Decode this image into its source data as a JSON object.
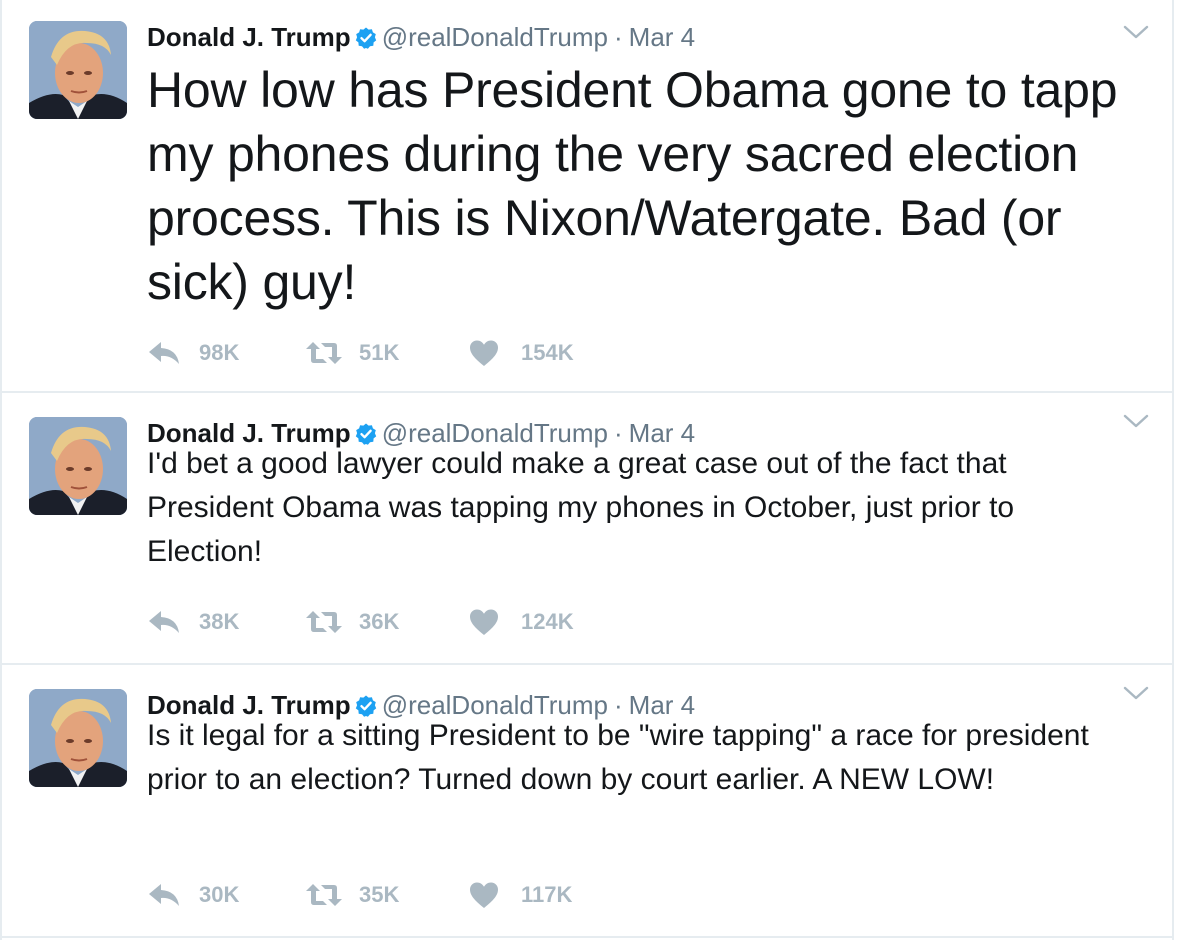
{
  "colors": {
    "text": "#14171a",
    "secondary": "#657786",
    "icon": "#aab8c2",
    "verified": "#1da1f2",
    "divider": "#e6ecf0"
  },
  "icons": {
    "verified": "verified-badge-icon",
    "menu": "chevron-down-icon",
    "reply": "reply-icon",
    "retweet": "retweet-icon",
    "like": "heart-icon"
  },
  "tweets": [
    {
      "author": {
        "name": "Donald J. Trump",
        "handle": "@realDonaldTrump"
      },
      "separator": "·",
      "date": "Mar 4",
      "text": "How low has President Obama gone to tapp my phones during the very sacred election process. This is Nixon/Watergate. Bad (or sick) guy!",
      "stats": {
        "replies": "98K",
        "retweets": "51K",
        "likes": "154K"
      }
    },
    {
      "author": {
        "name": "Donald J. Trump",
        "handle": "@realDonaldTrump"
      },
      "separator": "·",
      "date": "Mar 4",
      "text": "I'd bet a good lawyer could make a great case out of the fact that President Obama was tapping my phones in October, just prior to Election!",
      "stats": {
        "replies": "38K",
        "retweets": "36K",
        "likes": "124K"
      }
    },
    {
      "author": {
        "name": "Donald J. Trump",
        "handle": "@realDonaldTrump"
      },
      "separator": "·",
      "date": "Mar 4",
      "text": "Is it legal for a sitting President to be \"wire tapping\" a race for president prior to an election? Turned down by court earlier. A NEW LOW!",
      "stats": {
        "replies": "30K",
        "retweets": "35K",
        "likes": "117K"
      }
    }
  ]
}
